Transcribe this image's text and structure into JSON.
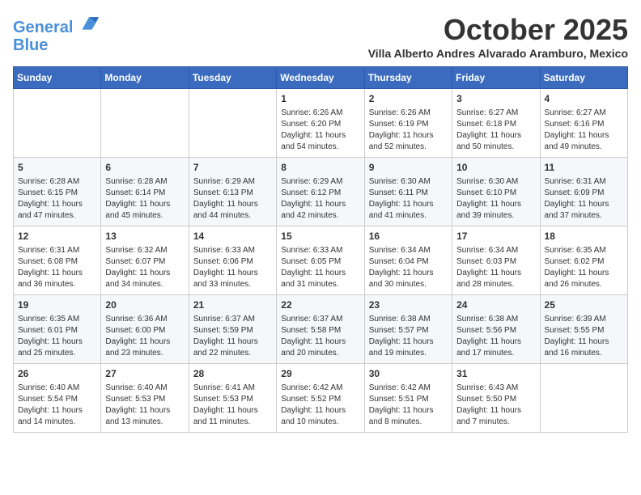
{
  "header": {
    "logo_line1": "General",
    "logo_line2": "Blue",
    "month_title": "October 2025",
    "location": "Villa Alberto Andres Alvarado Aramburo, Mexico"
  },
  "days_of_week": [
    "Sunday",
    "Monday",
    "Tuesday",
    "Wednesday",
    "Thursday",
    "Friday",
    "Saturday"
  ],
  "weeks": [
    [
      {
        "day": "",
        "info": ""
      },
      {
        "day": "",
        "info": ""
      },
      {
        "day": "",
        "info": ""
      },
      {
        "day": "1",
        "info": "Sunrise: 6:26 AM\nSunset: 6:20 PM\nDaylight: 11 hours and 54 minutes."
      },
      {
        "day": "2",
        "info": "Sunrise: 6:26 AM\nSunset: 6:19 PM\nDaylight: 11 hours and 52 minutes."
      },
      {
        "day": "3",
        "info": "Sunrise: 6:27 AM\nSunset: 6:18 PM\nDaylight: 11 hours and 50 minutes."
      },
      {
        "day": "4",
        "info": "Sunrise: 6:27 AM\nSunset: 6:16 PM\nDaylight: 11 hours and 49 minutes."
      }
    ],
    [
      {
        "day": "5",
        "info": "Sunrise: 6:28 AM\nSunset: 6:15 PM\nDaylight: 11 hours and 47 minutes."
      },
      {
        "day": "6",
        "info": "Sunrise: 6:28 AM\nSunset: 6:14 PM\nDaylight: 11 hours and 45 minutes."
      },
      {
        "day": "7",
        "info": "Sunrise: 6:29 AM\nSunset: 6:13 PM\nDaylight: 11 hours and 44 minutes."
      },
      {
        "day": "8",
        "info": "Sunrise: 6:29 AM\nSunset: 6:12 PM\nDaylight: 11 hours and 42 minutes."
      },
      {
        "day": "9",
        "info": "Sunrise: 6:30 AM\nSunset: 6:11 PM\nDaylight: 11 hours and 41 minutes."
      },
      {
        "day": "10",
        "info": "Sunrise: 6:30 AM\nSunset: 6:10 PM\nDaylight: 11 hours and 39 minutes."
      },
      {
        "day": "11",
        "info": "Sunrise: 6:31 AM\nSunset: 6:09 PM\nDaylight: 11 hours and 37 minutes."
      }
    ],
    [
      {
        "day": "12",
        "info": "Sunrise: 6:31 AM\nSunset: 6:08 PM\nDaylight: 11 hours and 36 minutes."
      },
      {
        "day": "13",
        "info": "Sunrise: 6:32 AM\nSunset: 6:07 PM\nDaylight: 11 hours and 34 minutes."
      },
      {
        "day": "14",
        "info": "Sunrise: 6:33 AM\nSunset: 6:06 PM\nDaylight: 11 hours and 33 minutes."
      },
      {
        "day": "15",
        "info": "Sunrise: 6:33 AM\nSunset: 6:05 PM\nDaylight: 11 hours and 31 minutes."
      },
      {
        "day": "16",
        "info": "Sunrise: 6:34 AM\nSunset: 6:04 PM\nDaylight: 11 hours and 30 minutes."
      },
      {
        "day": "17",
        "info": "Sunrise: 6:34 AM\nSunset: 6:03 PM\nDaylight: 11 hours and 28 minutes."
      },
      {
        "day": "18",
        "info": "Sunrise: 6:35 AM\nSunset: 6:02 PM\nDaylight: 11 hours and 26 minutes."
      }
    ],
    [
      {
        "day": "19",
        "info": "Sunrise: 6:35 AM\nSunset: 6:01 PM\nDaylight: 11 hours and 25 minutes."
      },
      {
        "day": "20",
        "info": "Sunrise: 6:36 AM\nSunset: 6:00 PM\nDaylight: 11 hours and 23 minutes."
      },
      {
        "day": "21",
        "info": "Sunrise: 6:37 AM\nSunset: 5:59 PM\nDaylight: 11 hours and 22 minutes."
      },
      {
        "day": "22",
        "info": "Sunrise: 6:37 AM\nSunset: 5:58 PM\nDaylight: 11 hours and 20 minutes."
      },
      {
        "day": "23",
        "info": "Sunrise: 6:38 AM\nSunset: 5:57 PM\nDaylight: 11 hours and 19 minutes."
      },
      {
        "day": "24",
        "info": "Sunrise: 6:38 AM\nSunset: 5:56 PM\nDaylight: 11 hours and 17 minutes."
      },
      {
        "day": "25",
        "info": "Sunrise: 6:39 AM\nSunset: 5:55 PM\nDaylight: 11 hours and 16 minutes."
      }
    ],
    [
      {
        "day": "26",
        "info": "Sunrise: 6:40 AM\nSunset: 5:54 PM\nDaylight: 11 hours and 14 minutes."
      },
      {
        "day": "27",
        "info": "Sunrise: 6:40 AM\nSunset: 5:53 PM\nDaylight: 11 hours and 13 minutes."
      },
      {
        "day": "28",
        "info": "Sunrise: 6:41 AM\nSunset: 5:53 PM\nDaylight: 11 hours and 11 minutes."
      },
      {
        "day": "29",
        "info": "Sunrise: 6:42 AM\nSunset: 5:52 PM\nDaylight: 11 hours and 10 minutes."
      },
      {
        "day": "30",
        "info": "Sunrise: 6:42 AM\nSunset: 5:51 PM\nDaylight: 11 hours and 8 minutes."
      },
      {
        "day": "31",
        "info": "Sunrise: 6:43 AM\nSunset: 5:50 PM\nDaylight: 11 hours and 7 minutes."
      },
      {
        "day": "",
        "info": ""
      }
    ]
  ]
}
